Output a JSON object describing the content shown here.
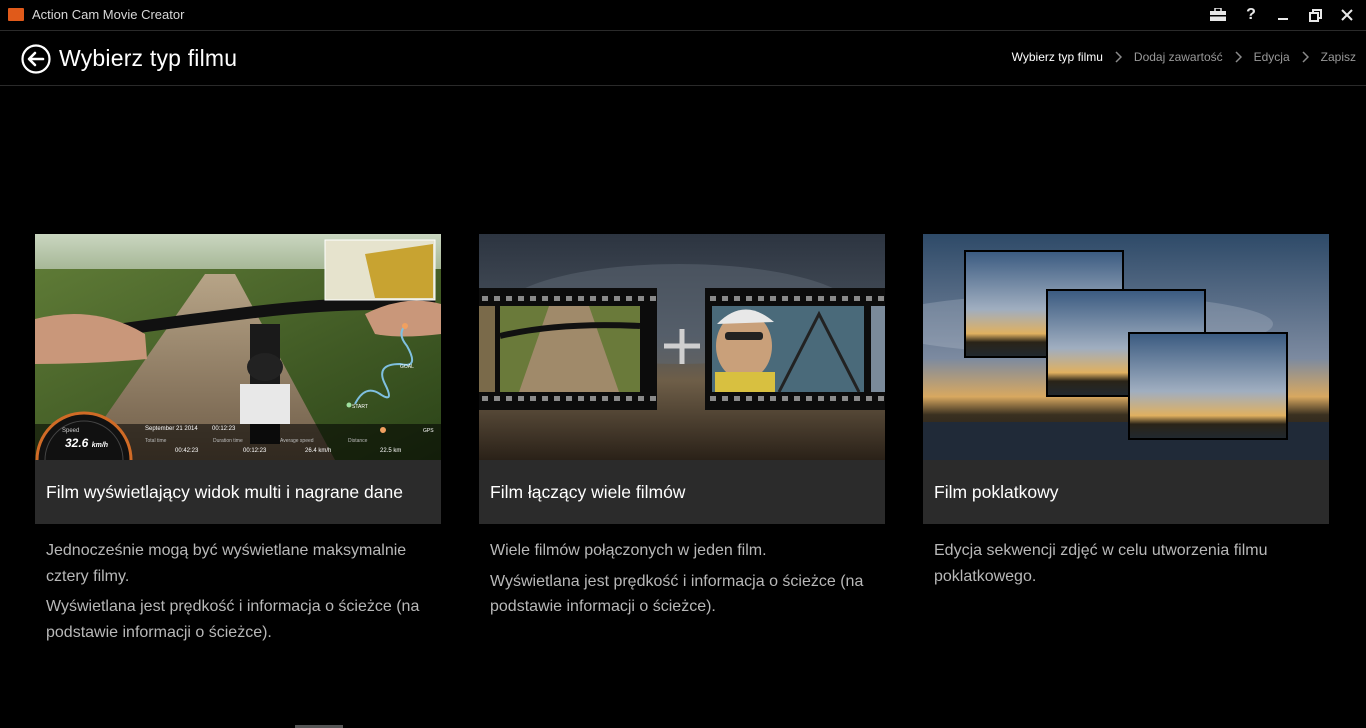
{
  "window": {
    "title": "Action Cam Movie Creator",
    "controls": [
      "toolbox-icon",
      "help-icon",
      "minimize-icon",
      "restore-icon",
      "close-icon"
    ]
  },
  "header": {
    "title": "Wybierz typ filmu",
    "breadcrumb": [
      "Wybierz typ filmu",
      "Dodaj zawartość",
      "Edycja",
      "Zapisz"
    ],
    "active_step": 0
  },
  "cards": [
    {
      "title": "Film wyświetlający widok multi i nagrane dane",
      "desc": [
        "Jednocześnie mogą być wyświetlane maksymalnie cztery filmy.",
        "Wyświetlana jest prędkość i informacja o ścieżce (na podstawie informacji o ścieżce)."
      ],
      "overlay": {
        "speed_label": "Speed",
        "speed_value": "32.6",
        "speed_unit": "km/h",
        "date": "September 21 2014",
        "clock": "00:12:23",
        "stats": [
          {
            "label": "Total time",
            "value": "00:42:23"
          },
          {
            "label": "Duration time",
            "value": "00:12:23"
          },
          {
            "label": "Average speed",
            "value": "26.4 km/h"
          },
          {
            "label": "Distance",
            "value": "22.5 km"
          }
        ],
        "goal": "GOAL",
        "start": "START",
        "gps": "GPS"
      }
    },
    {
      "title": "Film łączący wiele filmów",
      "desc": [
        "Wiele filmów połączonych w jeden film.",
        "Wyświetlana jest prędkość i informacja o ścieżce (na podstawie informacji o ścieżce)."
      ]
    },
    {
      "title": "Film poklatkowy",
      "desc": [
        "Edycja sekwencji zdjęć w celu utworzenia filmu poklatkowego."
      ]
    }
  ],
  "colors": {
    "background": "#000000",
    "caption": "#2b2b2b",
    "accent": "#e05a1a"
  }
}
